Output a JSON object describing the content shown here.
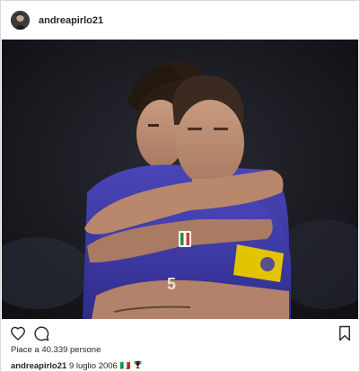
{
  "post": {
    "username": "andreapirlo21",
    "likes_text": "Piace a 40.339 persone",
    "caption": {
      "username": "andreapirlo21",
      "text": "9 luglio 2006 🇮🇹",
      "trophy_icon": "trophy-icon"
    },
    "actions": {
      "like_icon": "heart-icon",
      "comment_icon": "comment-bubble-icon",
      "save_icon": "bookmark-icon"
    },
    "photo_alt": ""
  },
  "colors": {
    "jersey_blue": "#3e3aa5",
    "captain_armband": "#e3c400",
    "text": "#262626",
    "border": "#dbdbdb"
  }
}
